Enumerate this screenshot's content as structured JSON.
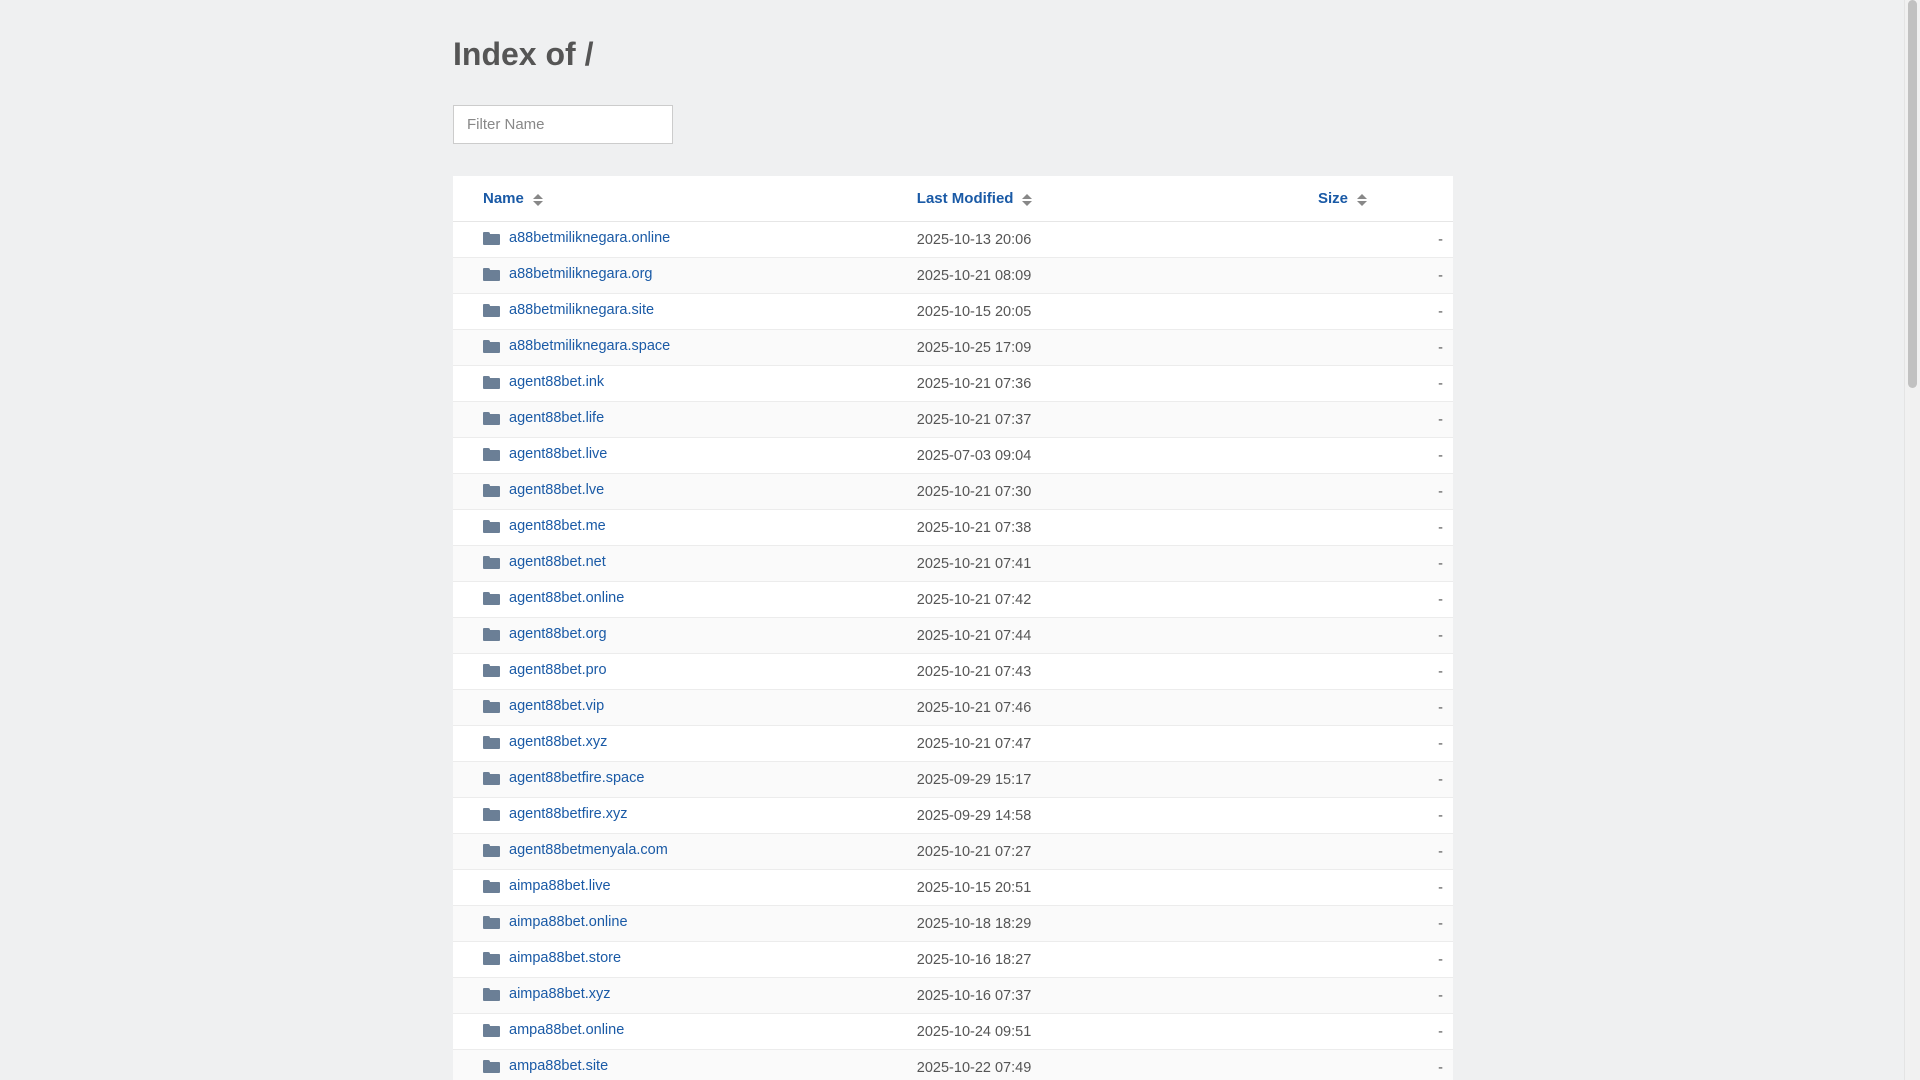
{
  "page": {
    "title": "Index of /"
  },
  "filter": {
    "placeholder": "Filter Name",
    "value": ""
  },
  "table": {
    "headers": {
      "name": "Name",
      "last_modified": "Last Modified",
      "size": "Size"
    },
    "rows": [
      {
        "name": "a88betmiliknegara.online",
        "modified": "2025-10-13 20:06",
        "size": "-"
      },
      {
        "name": "a88betmiliknegara.org",
        "modified": "2025-10-21 08:09",
        "size": "-"
      },
      {
        "name": "a88betmiliknegara.site",
        "modified": "2025-10-15 20:05",
        "size": "-"
      },
      {
        "name": "a88betmiliknegara.space",
        "modified": "2025-10-25 17:09",
        "size": "-"
      },
      {
        "name": "agent88bet.ink",
        "modified": "2025-10-21 07:36",
        "size": "-"
      },
      {
        "name": "agent88bet.life",
        "modified": "2025-10-21 07:37",
        "size": "-"
      },
      {
        "name": "agent88bet.live",
        "modified": "2025-07-03 09:04",
        "size": "-"
      },
      {
        "name": "agent88bet.lve",
        "modified": "2025-10-21 07:30",
        "size": "-"
      },
      {
        "name": "agent88bet.me",
        "modified": "2025-10-21 07:38",
        "size": "-"
      },
      {
        "name": "agent88bet.net",
        "modified": "2025-10-21 07:41",
        "size": "-"
      },
      {
        "name": "agent88bet.online",
        "modified": "2025-10-21 07:42",
        "size": "-"
      },
      {
        "name": "agent88bet.org",
        "modified": "2025-10-21 07:44",
        "size": "-"
      },
      {
        "name": "agent88bet.pro",
        "modified": "2025-10-21 07:43",
        "size": "-"
      },
      {
        "name": "agent88bet.vip",
        "modified": "2025-10-21 07:46",
        "size": "-"
      },
      {
        "name": "agent88bet.xyz",
        "modified": "2025-10-21 07:47",
        "size": "-"
      },
      {
        "name": "agent88betfire.space",
        "modified": "2025-09-29 15:17",
        "size": "-"
      },
      {
        "name": "agent88betfire.xyz",
        "modified": "2025-09-29 14:58",
        "size": "-"
      },
      {
        "name": "agent88betmenyala.com",
        "modified": "2025-10-21 07:27",
        "size": "-"
      },
      {
        "name": "aimpa88bet.live",
        "modified": "2025-10-15 20:51",
        "size": "-"
      },
      {
        "name": "aimpa88bet.online",
        "modified": "2025-10-18 18:29",
        "size": "-"
      },
      {
        "name": "aimpa88bet.store",
        "modified": "2025-10-16 18:27",
        "size": "-"
      },
      {
        "name": "aimpa88bet.xyz",
        "modified": "2025-10-16 07:37",
        "size": "-"
      },
      {
        "name": "ampa88bet.online",
        "modified": "2025-10-24 09:51",
        "size": "-"
      },
      {
        "name": "ampa88bet.site",
        "modified": "2025-10-22 07:49",
        "size": "-"
      }
    ]
  },
  "icons": {
    "folder": "folder-icon",
    "sort": "sort-icon"
  }
}
